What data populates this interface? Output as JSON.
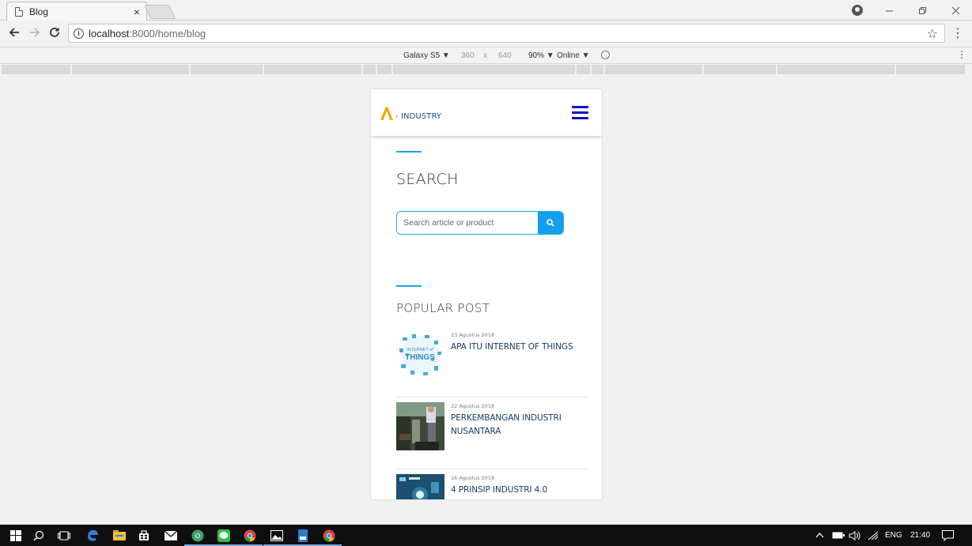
{
  "browser": {
    "tab_title": "Blog",
    "tab_close": "×",
    "url_host": "localhost",
    "url_rest": ":8000/home/blog"
  },
  "devtools": {
    "device": "Galaxy S5 ▼",
    "width": "360",
    "times": "x",
    "height": "640",
    "zoom": "90% ▼",
    "network": "Online ▼"
  },
  "site": {
    "logo_text": "- INDUSTRY",
    "brand_color": "#f5a800",
    "accent_color": "#19a8e0",
    "search": {
      "title": "SEARCH",
      "placeholder": "Search article or product"
    },
    "popular": {
      "title": "POPULAR POST",
      "posts": [
        {
          "date": "23 Agustus 2018",
          "title": "APA ITU INTERNET OF THINGS",
          "thumb_text_1": "INTERNET of",
          "thumb_text_2": "THINGS"
        },
        {
          "date": "22 Agustus 2018",
          "title": "PERKEMBANGAN INDUSTRI NUSANTARA"
        },
        {
          "date": "16 Agustus 2018",
          "title": "4 PRINSIP INDUSTRI 4.0"
        }
      ]
    }
  },
  "taskbar": {
    "lang": "ENG",
    "time": "21:40"
  }
}
